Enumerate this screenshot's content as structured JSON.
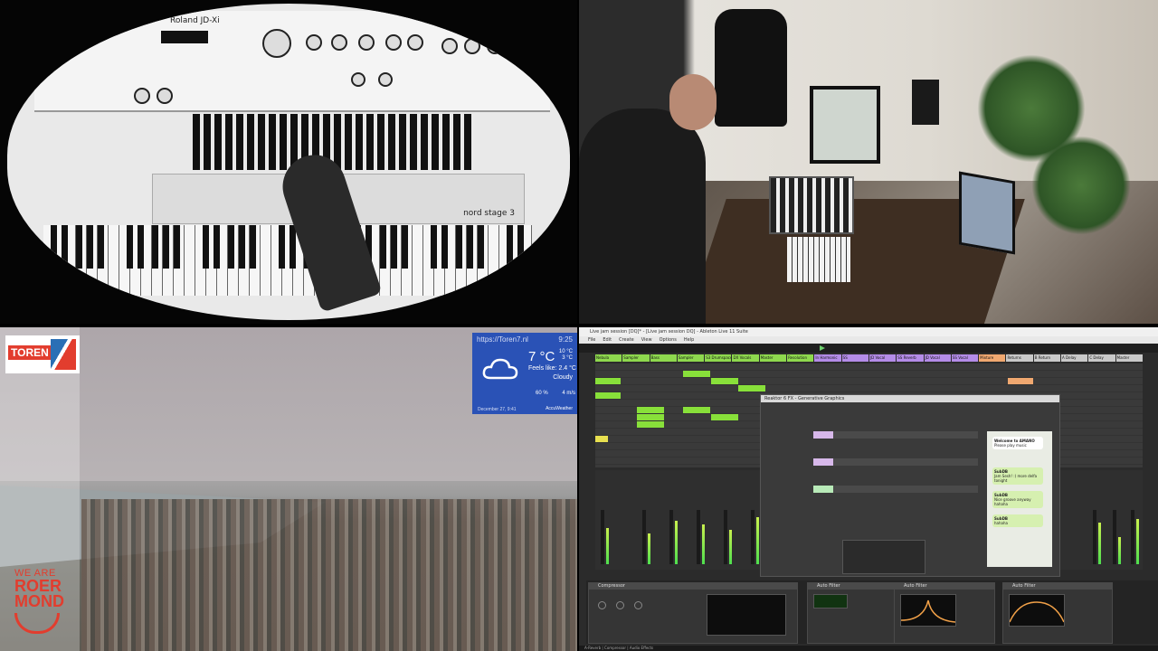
{
  "synth_cam": {
    "brand_label": "Roland  JD-Xi",
    "nord_label": "nord stage 3"
  },
  "webcam": {
    "logo_text": "TOREN",
    "roermond": {
      "line1": "WE ARE",
      "line2": "ROER",
      "line3": "MOND"
    },
    "weather": {
      "url": "https://Toren7.nl",
      "time": "9:25",
      "temperature": "7 °C",
      "range_high": "10 °C",
      "range_low": "3 °C",
      "feels_like": "Feels like: 2.4 °C",
      "condition": "Cloudy",
      "humidity": "60 %",
      "wind": "4 m/s",
      "date": "December 27, 9:41",
      "provider": "AccuWeather"
    }
  },
  "daw": {
    "window_title": "Live jam session [DQ]* - [Live jam session DQ] - Ableton Live 11 Suite",
    "menu": [
      "File",
      "Edit",
      "Create",
      "View",
      "Options",
      "Help"
    ],
    "tracks": [
      "Nebula",
      "Sampler",
      "Bass",
      "Sampler",
      "S3 Drumspace",
      "DX Vocals",
      "Master",
      "Resolution",
      "In Harmonic",
      "SS",
      "JD Vocal",
      "SS Reverb",
      "JD Vocal",
      "SS Vocal",
      "Mixture",
      "Returns",
      "B Return",
      "A Delay",
      "C Delay",
      "Master"
    ],
    "plugin_title": "Reaktor 6 FX - Generative Graphics",
    "chat": [
      {
        "user": "Welcome to AMANO",
        "text": "Please play music"
      },
      {
        "user": "SubDB",
        "text": "Jam Sesh! :) more delfa tonight"
      },
      {
        "user": "SubDB",
        "text": "Nice groove anyway hahaha"
      },
      {
        "user": "SubDB",
        "text": "hahaha"
      }
    ],
    "devices": [
      "Compressor",
      "Auto Filter",
      "Auto Filter",
      "Auto Filter"
    ],
    "status": "A-Reverb | Compressor | Audio Effects"
  }
}
